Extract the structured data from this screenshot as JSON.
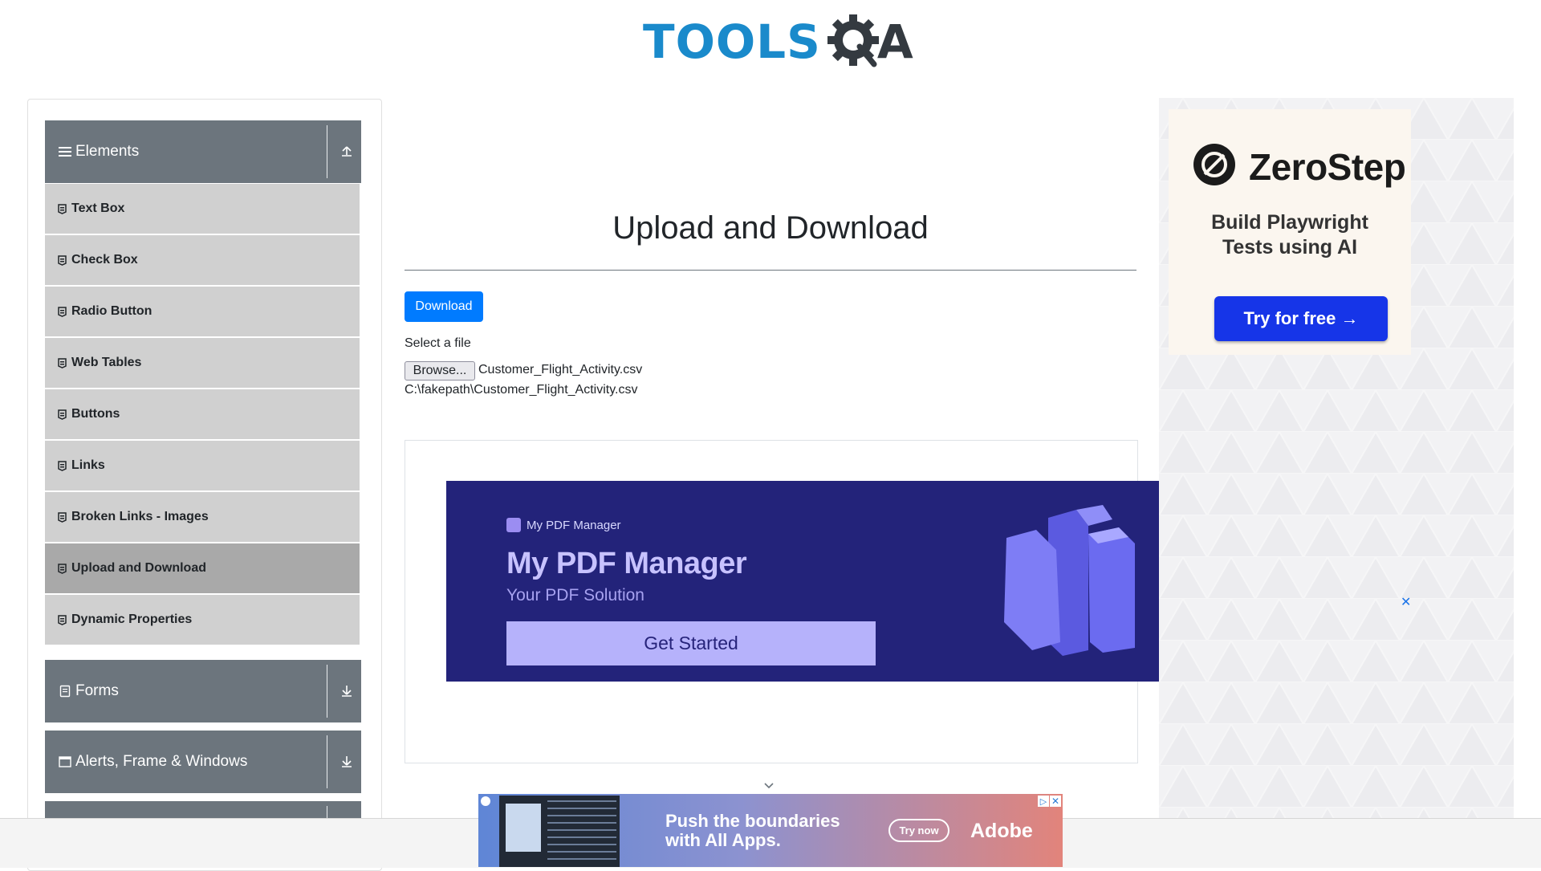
{
  "header": {
    "logo_text_left": "TOOLS",
    "logo_text_right": "A"
  },
  "sidebar": {
    "groups": [
      {
        "label": "Elements",
        "icon": "list-icon",
        "arrow": "upload-arrow-icon"
      },
      {
        "label": "Forms",
        "icon": "form-icon",
        "arrow": "download-arrow-icon"
      },
      {
        "label": "Alerts, Frame & Windows",
        "icon": "window-icon",
        "arrow": "download-arrow-icon"
      }
    ],
    "items": [
      {
        "label": "Text Box"
      },
      {
        "label": "Check Box"
      },
      {
        "label": "Radio Button"
      },
      {
        "label": "Web Tables"
      },
      {
        "label": "Buttons"
      },
      {
        "label": "Links"
      },
      {
        "label": "Broken Links - Images"
      },
      {
        "label": "Upload and Download",
        "active": true
      },
      {
        "label": "Dynamic Properties"
      }
    ]
  },
  "main": {
    "title": "Upload and Download",
    "download_label": "Download",
    "select_label": "Select a file",
    "browse_label": "Browse...",
    "file_name": "Customer_Flight_Activity.csv",
    "file_path": "C:\\fakepath\\Customer_Flight_Activity.csv"
  },
  "center_ad": {
    "brand": "My PDF Manager",
    "headline": "My PDF Manager",
    "subheadline": "Your PDF Solution",
    "cta": "Get Started"
  },
  "right_ad": {
    "brand": "ZeroStep",
    "tagline_line1": "Build Playwright",
    "tagline_line2": "Tests using AI",
    "cta": "Try for free →",
    "close": "✕"
  },
  "bottom_ad": {
    "text_line1": "Push the boundaries",
    "text_line2": "with All Apps.",
    "cta": "Try now",
    "brand": "Adobe",
    "info": "▷",
    "close": "✕"
  },
  "colors": {
    "accent": "#007bff",
    "sidebar_group": "#6c757d",
    "sidebar_item": "#d0d0d0",
    "sidebar_item_active": "#a9a9a9",
    "logo_blue": "#1a8acb",
    "logo_dark": "#343a40"
  }
}
